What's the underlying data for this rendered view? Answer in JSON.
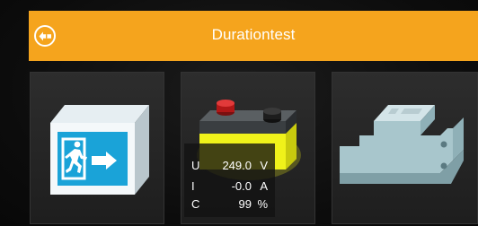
{
  "header": {
    "title": "Durationtest",
    "back_icon": "back-icon",
    "color": "#f5a41d"
  },
  "tiles": [
    {
      "id": "emergency-exit",
      "icon": "emergency-exit-sign-icon"
    },
    {
      "id": "battery",
      "icon": "battery-icon"
    },
    {
      "id": "module",
      "icon": "din-rail-module-icon"
    }
  ],
  "readout": {
    "rows": [
      {
        "symbol": "U",
        "value": "249.0",
        "unit": "V"
      },
      {
        "symbol": "I",
        "value": "-0.0",
        "unit": "A"
      },
      {
        "symbol": "C",
        "value": "99",
        "unit": "%"
      }
    ]
  },
  "colors": {
    "accent": "#f5a41d",
    "exit_sign": "#1aa3d8",
    "battery_glow": "#f2f215",
    "module": "#a8c6cc"
  }
}
